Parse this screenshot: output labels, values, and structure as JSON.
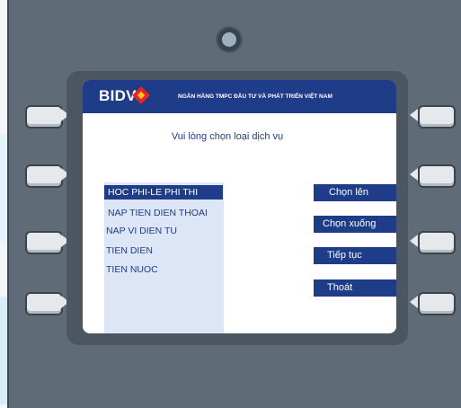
{
  "screen": {
    "logo_text": "BIDV",
    "bank_name": "NGÂN HÀNG TMPC ĐẦU TƯ VÀ PHÁT TRIỂN VIỆT NAM",
    "prompt": "Vui lòng chọn loại dịch vụ",
    "services": [
      "HOC PHI-LE PHI THI",
      "NAP TIEN DIEN THOAI",
      "NAP VI DIEN TU",
      "TIEN DIEN",
      "TIEN NUOC"
    ],
    "selected_service": "HOC PHI-LE PHI THI",
    "menu": {
      "up": "Chọn lên",
      "down": "Chọn xuống",
      "continue": "Tiếp tục",
      "exit": "Thoát"
    }
  },
  "colors": {
    "brand_blue": "#1f3c88",
    "atm_body": "#5f6c78",
    "list_bg": "#dde6f6",
    "logo_red": "#e52521",
    "logo_yellow": "#f9c61f"
  },
  "icons": [
    "atm-camera-icon",
    "bidv-logo-mark-icon"
  ]
}
